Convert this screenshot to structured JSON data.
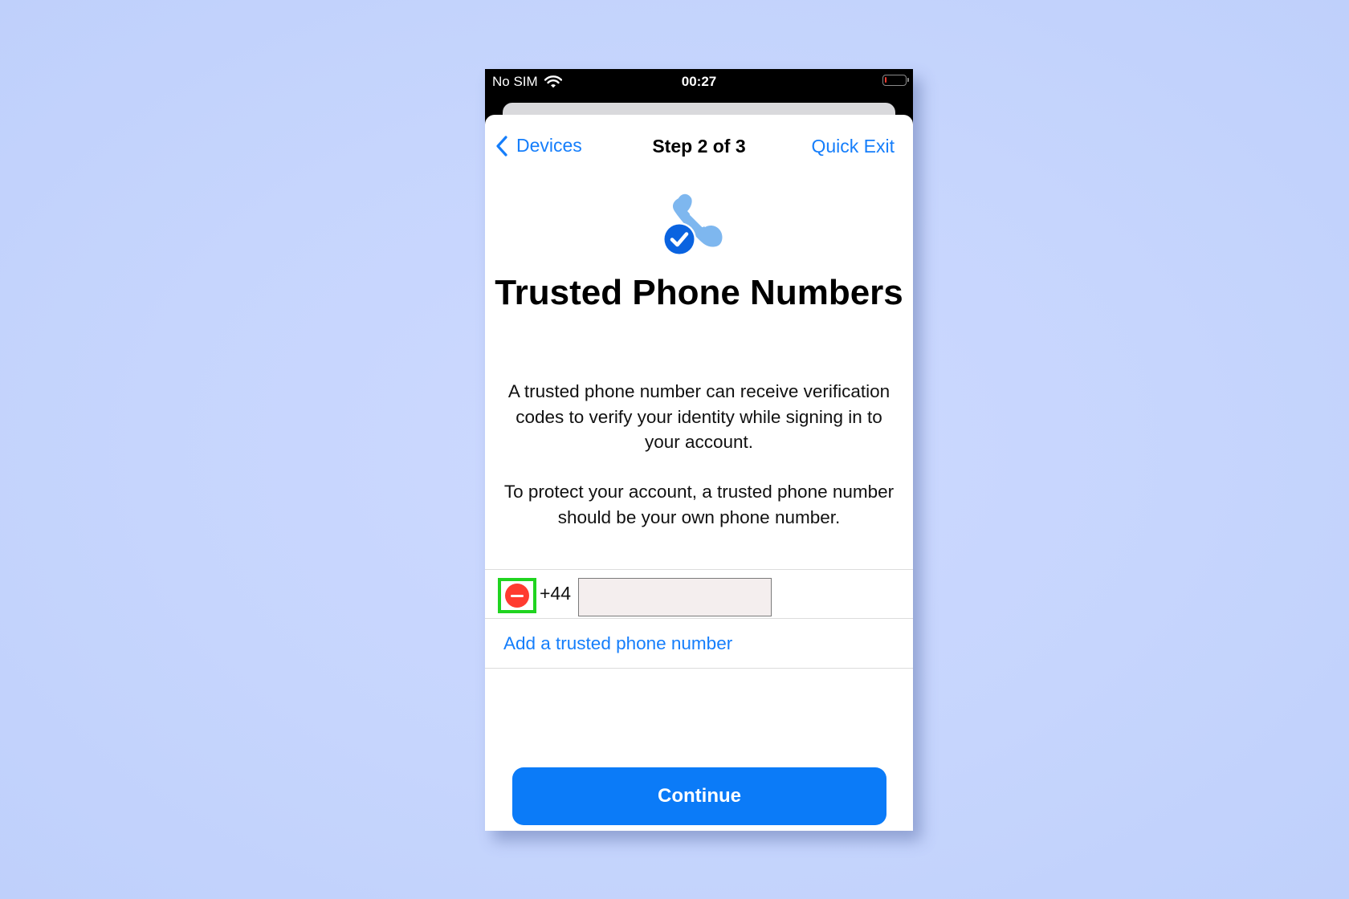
{
  "status_bar": {
    "carrier": "No SIM",
    "time": "00:27",
    "battery_level": 0.1,
    "battery_color": "#ff3b30"
  },
  "nav": {
    "back_label": "Devices",
    "title": "Step 2 of 3",
    "quick_exit_label": "Quick Exit"
  },
  "page": {
    "title": "Trusted Phone Numbers",
    "description_1": "A trusted phone number can receive verification codes to verify your identity while signing in to your account.",
    "description_2": "To protect your account, a trusted phone number should be your own phone number."
  },
  "phone_entry": {
    "country_code": "+44",
    "value": "",
    "placeholder": ""
  },
  "add_link_label": "Add a trusted phone number",
  "continue_label": "Continue",
  "colors": {
    "accent": "#157efb",
    "button": "#0b7bf8",
    "delete": "#ff3b30",
    "highlight": "#20d420"
  },
  "icons": {
    "wifi": "wifi-icon",
    "battery": "battery-icon",
    "back": "chevron-left-icon",
    "hero": "phone-checkmark-icon",
    "delete": "minus-circle-icon"
  }
}
